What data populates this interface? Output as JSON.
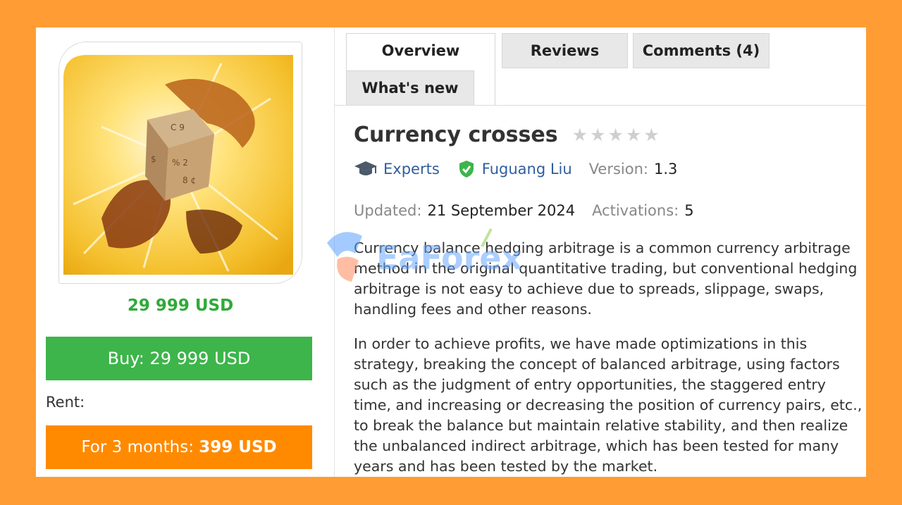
{
  "product": {
    "price": "29 999 USD",
    "buy_label": "Buy: 29 999 USD",
    "rent_label": "Rent:",
    "rent_prefix": "For 3 months: ",
    "rent_price": "399 USD"
  },
  "tabs": [
    {
      "label": "Overview",
      "active": true
    },
    {
      "label": "Reviews"
    },
    {
      "label": "Comments (4)"
    },
    {
      "label": "What's new"
    }
  ],
  "header": {
    "title": "Currency crosses",
    "rating": 0,
    "category": "Experts",
    "author": "Fuguang Liu",
    "version_label": "Version:",
    "version": "1.3",
    "updated_label": "Updated:",
    "updated": "21 September 2024",
    "activations_label": "Activations:",
    "activations": "5"
  },
  "description": [
    "Currency balance hedging arbitrage is a common currency arbitrage method in the original quantitative trading, but conventional hedging arbitrage is not easy to achieve due to spreads, slippage, swaps, handling fees and other reasons.",
    "In order to achieve profits, we have made optimizations in this strategy, breaking the concept of balanced arbitrage, using factors such as the judgment of entry opportunities, the staggered entry time, and increasing or decreasing the position of currency pairs, etc., to break the balance but maintain relative stability, and then realize the unbalanced indirect arbitrage, which has been tested for many years and has been tested by the market."
  ],
  "watermark": "EaForex",
  "icons": {
    "category": "graduation-cap-icon",
    "author": "verified-shield-icon",
    "stars": "star-icon"
  },
  "colors": {
    "background": "#ff9c33",
    "buy": "#3db54a",
    "rent": "#ff8a00",
    "price": "#2faa39",
    "link": "#2f5e9e"
  }
}
